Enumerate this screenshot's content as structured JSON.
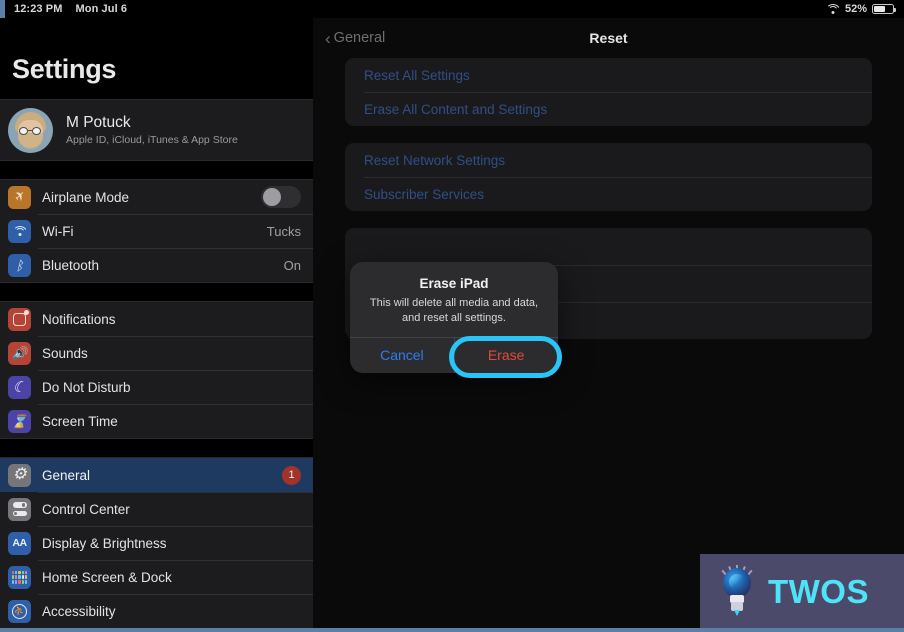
{
  "status_bar": {
    "time": "12:23 PM",
    "date": "Mon Jul 6",
    "wifi_icon": "wifi-icon",
    "battery_percent": "52%",
    "battery_icon": "battery-icon"
  },
  "sidebar": {
    "title": "Settings",
    "account": {
      "name": "M Potuck",
      "subtitle": "Apple ID, iCloud, iTunes & App Store",
      "avatar_icon": "memoji-avatar"
    },
    "groups": [
      {
        "items": [
          {
            "label": "Airplane Mode",
            "icon": "airplane-icon",
            "icon_color": "#b9762a",
            "control": "toggle",
            "toggle_on": false
          },
          {
            "label": "Wi-Fi",
            "icon": "wifi-icon",
            "icon_color": "#2f5fa8",
            "value": "Tucks"
          },
          {
            "label": "Bluetooth",
            "icon": "bluetooth-icon",
            "icon_color": "#2f5fa8",
            "value": "On"
          }
        ]
      },
      {
        "items": [
          {
            "label": "Notifications",
            "icon": "notifications-icon",
            "icon_color": "#b54436"
          },
          {
            "label": "Sounds",
            "icon": "speaker-icon",
            "icon_color": "#b54436"
          },
          {
            "label": "Do Not Disturb",
            "icon": "moon-icon",
            "icon_color": "#4b43a8"
          },
          {
            "label": "Screen Time",
            "icon": "hourglass-icon",
            "icon_color": "#4b43a8"
          }
        ]
      },
      {
        "items": [
          {
            "label": "General",
            "icon": "gear-icon",
            "icon_color": "#76767a",
            "selected": true,
            "badge": "1"
          },
          {
            "label": "Control Center",
            "icon": "control-center-icon",
            "icon_color": "#76767a"
          },
          {
            "label": "Display & Brightness",
            "icon": "display-brightness-icon",
            "icon_color": "#2f5fa8"
          },
          {
            "label": "Home Screen & Dock",
            "icon": "home-screen-dock-icon",
            "icon_color": "#2f5fa8"
          },
          {
            "label": "Accessibility",
            "icon": "accessibility-icon",
            "icon_color": "#2f5fa8"
          }
        ]
      }
    ]
  },
  "main": {
    "back_label": "General",
    "back_chevron_icon": "chevron-left-icon",
    "title": "Reset",
    "groups": [
      {
        "items": [
          "Reset All Settings",
          "Erase All Content and Settings"
        ]
      },
      {
        "items": [
          "Reset Network Settings",
          "Subscriber Services"
        ]
      },
      {
        "items": [
          "",
          "",
          ""
        ]
      }
    ]
  },
  "alert": {
    "title": "Erase iPad",
    "message": "This will delete all media and data, and reset all settings.",
    "cancel_label": "Cancel",
    "confirm_label": "Erase",
    "highlight_color": "#29c5f6"
  },
  "watermark": {
    "text": "TWOS",
    "icon": "lightbulb-icon"
  }
}
